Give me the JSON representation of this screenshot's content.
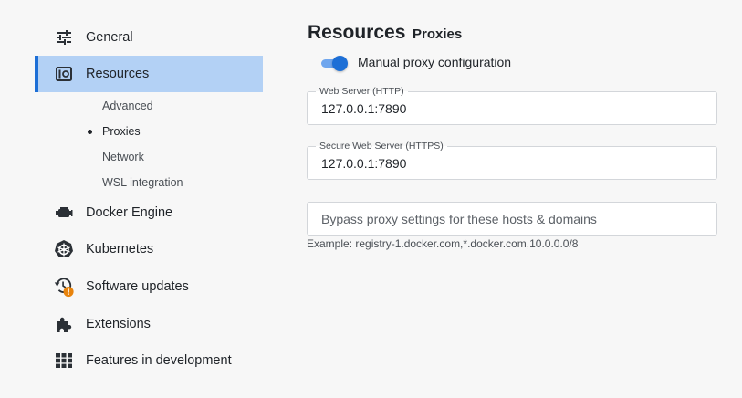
{
  "sidebar": {
    "items": [
      {
        "label": "General",
        "icon": "sliders-icon"
      },
      {
        "label": "Resources",
        "icon": "resources-icon"
      },
      {
        "label": "Docker Engine",
        "icon": "docker-engine-icon"
      },
      {
        "label": "Kubernetes",
        "icon": "kubernetes-icon"
      },
      {
        "label": "Software updates",
        "icon": "software-updates-icon"
      },
      {
        "label": "Extensions",
        "icon": "puzzle-icon"
      },
      {
        "label": "Features in development",
        "icon": "grid-icon"
      }
    ],
    "resources_sub": [
      {
        "label": "Advanced"
      },
      {
        "label": "Proxies"
      },
      {
        "label": "Network"
      },
      {
        "label": "WSL integration"
      }
    ],
    "active_item": "Resources",
    "active_sub": "Proxies"
  },
  "main": {
    "title": "Resources",
    "subtitle": "Proxies",
    "manual_proxy": {
      "label": "Manual proxy configuration",
      "enabled": true
    },
    "http": {
      "legend": "Web Server (HTTP)",
      "value": "127.0.0.1:7890"
    },
    "https": {
      "legend": "Secure Web Server (HTTPS)",
      "value": "127.0.0.1:7890"
    },
    "bypass": {
      "placeholder": "Bypass proxy settings for these hosts & domains",
      "value": ""
    },
    "hint": "Example: registry-1.docker.com,*.docker.com,10.0.0.0/8"
  },
  "colors": {
    "accent": "#1d6fd6",
    "active_bg": "#b3d1f5",
    "warning_badge": "#e8830c",
    "background": "#f7f7f7"
  }
}
